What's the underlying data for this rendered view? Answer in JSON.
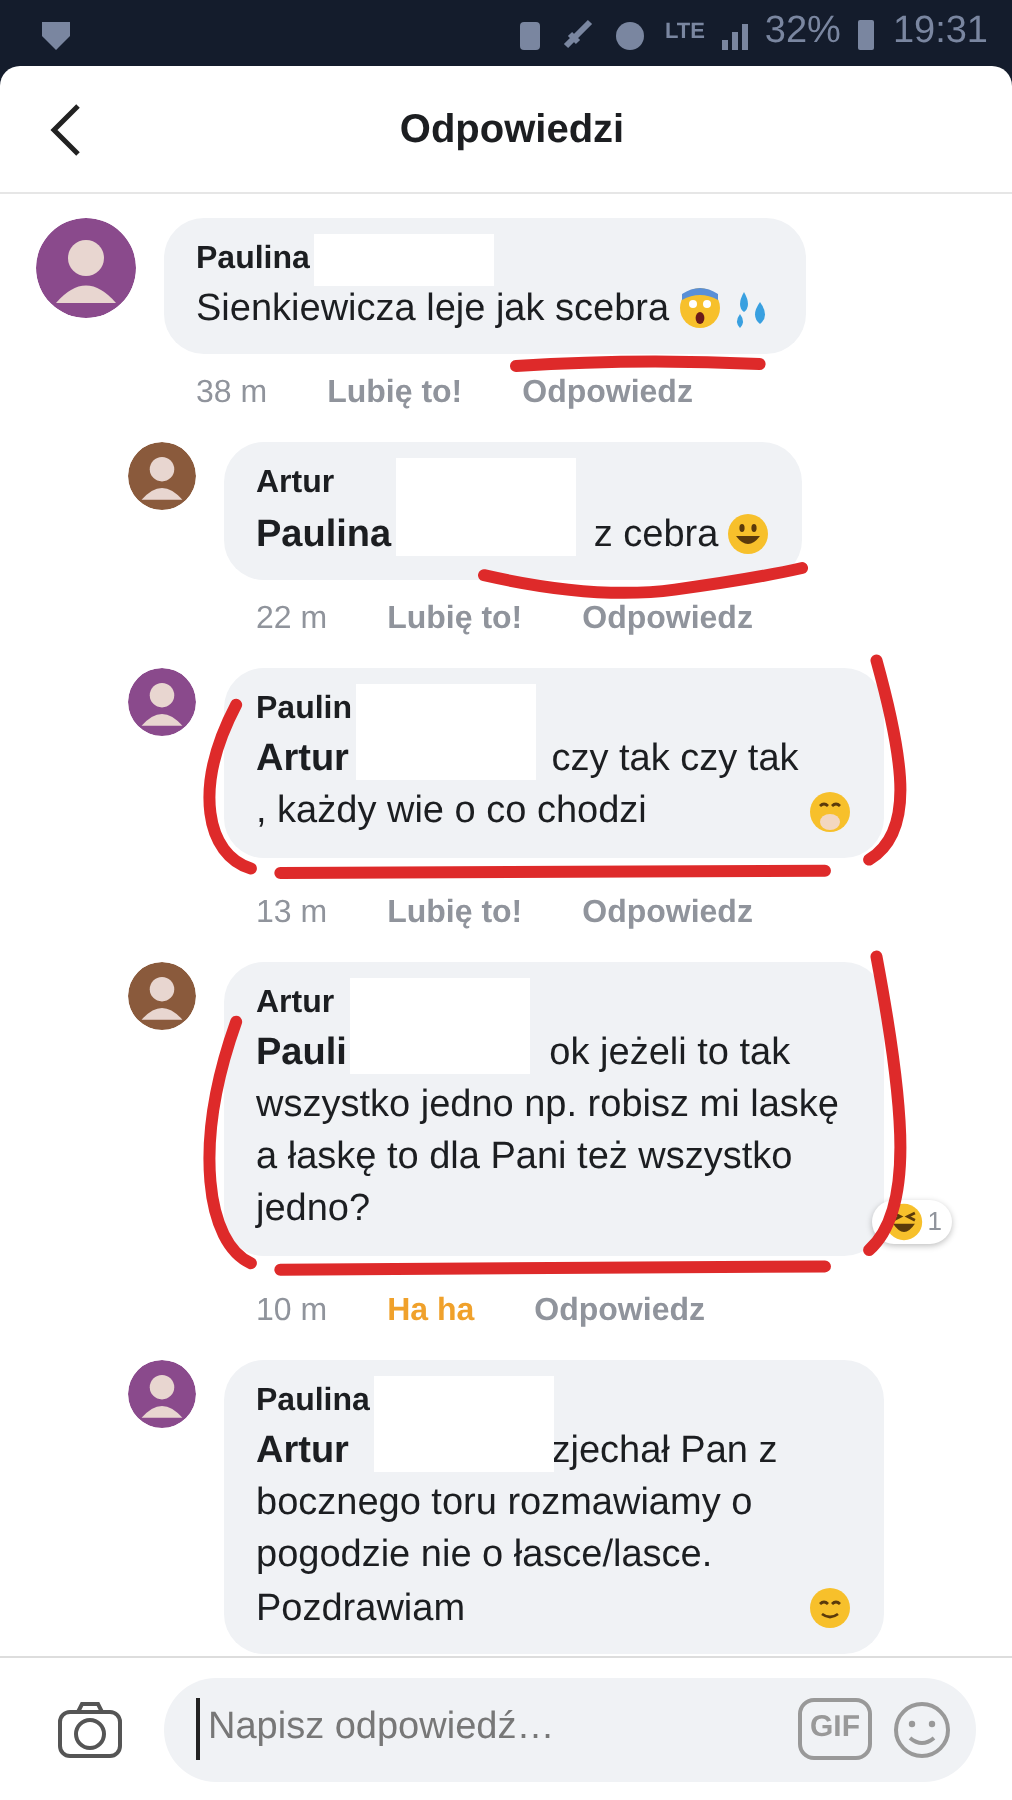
{
  "status_bar": {
    "network": "LTE",
    "battery": "32%",
    "time": "19:31"
  },
  "header": {
    "title": "Odpowiedzi"
  },
  "comments": [
    {
      "author": "Paulina",
      "color": "#8a4a8c",
      "text": "Sienkiewicza leje  jak scebra",
      "icons": [
        {
          "kind": "scream"
        },
        {
          "kind": "droplets"
        }
      ],
      "kind": "underlined",
      "time": "38 m",
      "like": "Lubię to!",
      "reacted": false,
      "reply": "Odpowiedz",
      "children": [
        {
          "author": "Artur",
          "color": "#8a5a3c",
          "text": "**Paulina** z cebra",
          "icons": [
            {
              "kind": "grin"
            }
          ],
          "kind": "swooshed",
          "time": "22 m",
          "like": "Lubię to!",
          "reacted": false,
          "reply": "Odpowiedz"
        },
        {
          "author": "Paulin",
          "color": "#8a4a8c",
          "text": "**Artur** czy tak czy tak , każdy wie o co chodzi",
          "icons": [
            {
              "kind": "hand-over-mouth"
            }
          ],
          "kind": "circled",
          "time": "13 m",
          "like": "Lubię to!",
          "reacted": false,
          "reply": "Odpowiedz"
        },
        {
          "author": "Artur",
          "color": "#8a5a3c",
          "text": "**Pauli** ok jeżeli to tak wszystko jedno np. robisz mi laskę a łaskę to dla Pani też wszystko jedno?",
          "reactions": {
            "kind": "laugh",
            "count": "1"
          },
          "kind": "circled",
          "time": "10 m",
          "like": "Ha ha",
          "reacted": true,
          "reply": "Odpowiedz"
        },
        {
          "author": "Paulina",
          "color": "#8a4a8c",
          "text": "**Artur** zjechał Pan z bocznego toru rozmawiamy o pogodzie nie o łasce/lasce. Pozdrawiam",
          "icons": [
            {
              "kind": "smile"
            }
          ],
          "kind": "plain"
        }
      ]
    }
  ],
  "composer": {
    "placeholder": "Napisz odpowiedź…",
    "gif": "GIF"
  }
}
